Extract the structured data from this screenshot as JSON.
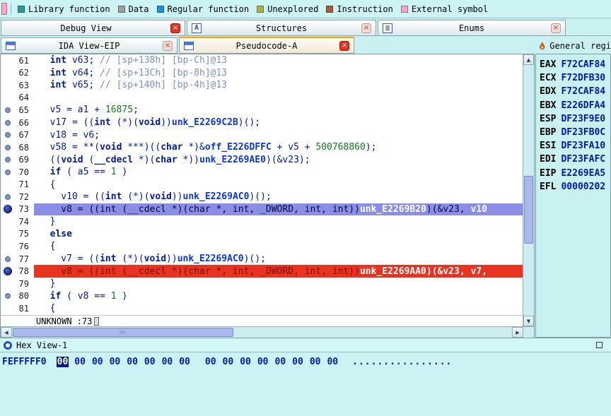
{
  "colors": {
    "highlight_selected": "#8a8ee6",
    "highlight_current": "#e93321",
    "tab_accent": "#ffa000",
    "close_button": "#e6321e"
  },
  "legend": {
    "items": [
      {
        "label": "Library function",
        "color": "#2f9a9a"
      },
      {
        "label": "Data",
        "color": "#9c9c9c"
      },
      {
        "label": "Regular function",
        "color": "#2090e0"
      },
      {
        "label": "Unexplored",
        "color": "#aab044"
      },
      {
        "label": "Instruction",
        "color": "#aa5a3c"
      },
      {
        "label": "External symbol",
        "color": "#f8a0d0"
      }
    ]
  },
  "tabs_row1": {
    "debug": "Debug View",
    "structures": "Structures",
    "enums": "Enums"
  },
  "tabs_row2": {
    "ida_view": "IDA View-EIP",
    "pseudocode": "Pseudocode-A"
  },
  "registers": {
    "title": "General regi",
    "rows": [
      [
        "EAX",
        "F72CAF84"
      ],
      [
        "ECX",
        "F72DFB30"
      ],
      [
        "EDX",
        "F72CAF84"
      ],
      [
        "EBX",
        "E226DFA4"
      ],
      [
        "ESP",
        "DF23F9E0"
      ],
      [
        "EBP",
        "DF23FB0C"
      ],
      [
        "ESI",
        "DF23FA10"
      ],
      [
        "EDI",
        "DF23FAFC"
      ],
      [
        "EIP",
        "E2269EA5"
      ],
      [
        "EFL",
        "00000202"
      ]
    ]
  },
  "code": {
    "status": "UNKNOWN :73",
    "lines": [
      {
        "n": 61,
        "bp": 0,
        "hl": "",
        "segs": [
          [
            "  ",
            "p"
          ],
          [
            "int",
            "k"
          ],
          [
            " v63; ",
            "p"
          ],
          [
            "// [sp+138h] [bp-Ch]@13",
            "c"
          ]
        ]
      },
      {
        "n": 62,
        "bp": 0,
        "hl": "",
        "segs": [
          [
            "  ",
            "p"
          ],
          [
            "int",
            "k"
          ],
          [
            " v64; ",
            "p"
          ],
          [
            "// [sp+13Ch] [bp-8h]@13",
            "c"
          ]
        ]
      },
      {
        "n": 63,
        "bp": 0,
        "hl": "",
        "segs": [
          [
            "  ",
            "p"
          ],
          [
            "int",
            "k"
          ],
          [
            " v65; ",
            "p"
          ],
          [
            "// [sp+140h] [bp-4h]@13",
            "c"
          ]
        ]
      },
      {
        "n": 64,
        "bp": 0,
        "hl": "",
        "segs": []
      },
      {
        "n": 65,
        "bp": 1,
        "hl": "",
        "segs": [
          [
            "  v5 = a1 + ",
            "p"
          ],
          [
            "16875",
            "n"
          ],
          [
            ";",
            "p"
          ]
        ]
      },
      {
        "n": 66,
        "bp": 1,
        "hl": "",
        "segs": [
          [
            "  v17 = ((",
            "p"
          ],
          [
            "int",
            "k"
          ],
          [
            " (*)(",
            "p"
          ],
          [
            "void",
            "k"
          ],
          [
            "))",
            "p"
          ],
          [
            "unk_E2269C2B",
            "m"
          ],
          [
            ")();",
            "p"
          ]
        ]
      },
      {
        "n": 67,
        "bp": 1,
        "hl": "",
        "segs": [
          [
            "  v18 = v6;",
            "p"
          ]
        ]
      },
      {
        "n": 68,
        "bp": 1,
        "hl": "",
        "segs": [
          [
            "  v58 = **(",
            "p"
          ],
          [
            "void",
            "k"
          ],
          [
            " ***)((",
            "p"
          ],
          [
            "char",
            "k"
          ],
          [
            " *)&",
            "p"
          ],
          [
            "off_E226DFFC",
            "m"
          ],
          [
            " + v5 + ",
            "p"
          ],
          [
            "500768860",
            "n"
          ],
          [
            ");",
            "p"
          ]
        ]
      },
      {
        "n": 69,
        "bp": 1,
        "hl": "",
        "segs": [
          [
            "  ((",
            "p"
          ],
          [
            "void",
            "k"
          ],
          [
            " (",
            "p"
          ],
          [
            "__cdecl",
            "k"
          ],
          [
            " *)(",
            "p"
          ],
          [
            "char",
            "k"
          ],
          [
            " *))",
            "p"
          ],
          [
            "unk_E2269AE0",
            "m"
          ],
          [
            ")(&v23);",
            "p"
          ]
        ]
      },
      {
        "n": 70,
        "bp": 1,
        "hl": "",
        "segs": [
          [
            "  ",
            "p"
          ],
          [
            "if",
            "k"
          ],
          [
            " ( a5 == ",
            "p"
          ],
          [
            "1",
            "n"
          ],
          [
            " )",
            "p"
          ]
        ]
      },
      {
        "n": 71,
        "bp": 0,
        "hl": "",
        "segs": [
          [
            "  {",
            "p"
          ]
        ]
      },
      {
        "n": 72,
        "bp": 1,
        "hl": "",
        "segs": [
          [
            "    v10 = ((",
            "p"
          ],
          [
            "int",
            "k"
          ],
          [
            " (*)(",
            "p"
          ],
          [
            "void",
            "k"
          ],
          [
            "))",
            "p"
          ],
          [
            "unk_E2269AC0",
            "m"
          ],
          [
            ")();",
            "p"
          ]
        ]
      },
      {
        "n": 73,
        "bp": 2,
        "hl": "blue",
        "segs": [
          [
            "    v8 = ((int (__cdecl *)(char *, int, _DWORD, int, int))",
            "hd"
          ],
          [
            "unk_E2269B20",
            "hw"
          ],
          [
            ")(&v23, ",
            "hd"
          ],
          [
            "v10",
            "hw"
          ]
        ]
      },
      {
        "n": 74,
        "bp": 0,
        "hl": "",
        "segs": [
          [
            "  }",
            "p"
          ]
        ]
      },
      {
        "n": 75,
        "bp": 0,
        "hl": "",
        "segs": [
          [
            "  ",
            "p"
          ],
          [
            "else",
            "k"
          ]
        ]
      },
      {
        "n": 76,
        "bp": 0,
        "hl": "",
        "segs": [
          [
            "  {",
            "p"
          ]
        ]
      },
      {
        "n": 77,
        "bp": 1,
        "hl": "",
        "segs": [
          [
            "    v7 = ((",
            "p"
          ],
          [
            "int",
            "k"
          ],
          [
            " (*)(",
            "p"
          ],
          [
            "void",
            "k"
          ],
          [
            "))",
            "p"
          ],
          [
            "unk_E2269AC0",
            "m"
          ],
          [
            ")();",
            "p"
          ]
        ]
      },
      {
        "n": 78,
        "bp": 2,
        "hl": "red",
        "segs": [
          [
            "    v8 = ((int (__cdecl *)(char *, int, _DWORD, int, int))",
            "rd"
          ],
          [
            "unk_E2269AA0",
            "rw"
          ],
          [
            ")(&v23, v7,",
            "rw"
          ]
        ]
      },
      {
        "n": 79,
        "bp": 0,
        "hl": "",
        "segs": [
          [
            "  }",
            "p"
          ]
        ]
      },
      {
        "n": 80,
        "bp": 1,
        "hl": "",
        "segs": [
          [
            "  ",
            "p"
          ],
          [
            "if",
            "k"
          ],
          [
            " ( v8 == ",
            "p"
          ],
          [
            "1",
            "n"
          ],
          [
            " )",
            "p"
          ]
        ]
      },
      {
        "n": 81,
        "bp": 0,
        "hl": "",
        "segs": [
          [
            "  {",
            "p"
          ]
        ]
      }
    ]
  },
  "hex": {
    "title": "Hex View-1",
    "address": "FEFFFFF0",
    "bytes": [
      "00",
      "00",
      "00",
      "00",
      "00",
      "00",
      "00",
      "00",
      "00",
      "00",
      "00",
      "00",
      "00",
      "00",
      "00",
      "00"
    ],
    "selected_index": 0,
    "ascii": "................"
  }
}
